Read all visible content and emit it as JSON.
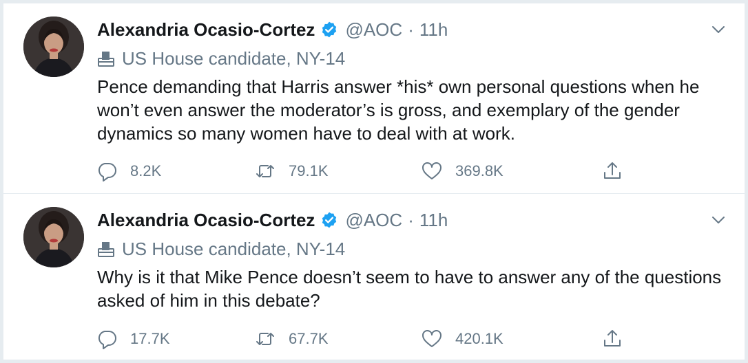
{
  "tweets": [
    {
      "author": {
        "name": "Alexandria Ocasio-Cortez",
        "handle": "@AOC",
        "time": "11h",
        "verified": true
      },
      "label": "US House candidate, NY-14",
      "text": "Pence demanding that Harris answer *his* own personal questions when he won’t even answer the moderator’s is gross, and exemplary of the gender dynamics so many women have to deal with at work.",
      "actions": {
        "replies": "8.2K",
        "retweets": "79.1K",
        "likes": "369.8K"
      }
    },
    {
      "author": {
        "name": "Alexandria Ocasio-Cortez",
        "handle": "@AOC",
        "time": "11h",
        "verified": true
      },
      "label": "US House candidate, NY-14",
      "text": "Why is it that Mike Pence doesn’t seem to have to answer any of the questions asked of him in this debate?",
      "actions": {
        "replies": "17.7K",
        "retweets": "67.7K",
        "likes": "420.1K"
      }
    }
  ],
  "icons": {
    "verified": "verified-badge-icon",
    "label": "ballot-box-icon",
    "menu": "chevron-down-icon",
    "reply": "reply-icon",
    "retweet": "retweet-icon",
    "like": "heart-icon",
    "share": "share-icon"
  },
  "colors": {
    "verified": "#1da1f2",
    "secondary_text": "#657786",
    "primary_text": "#14171a"
  }
}
